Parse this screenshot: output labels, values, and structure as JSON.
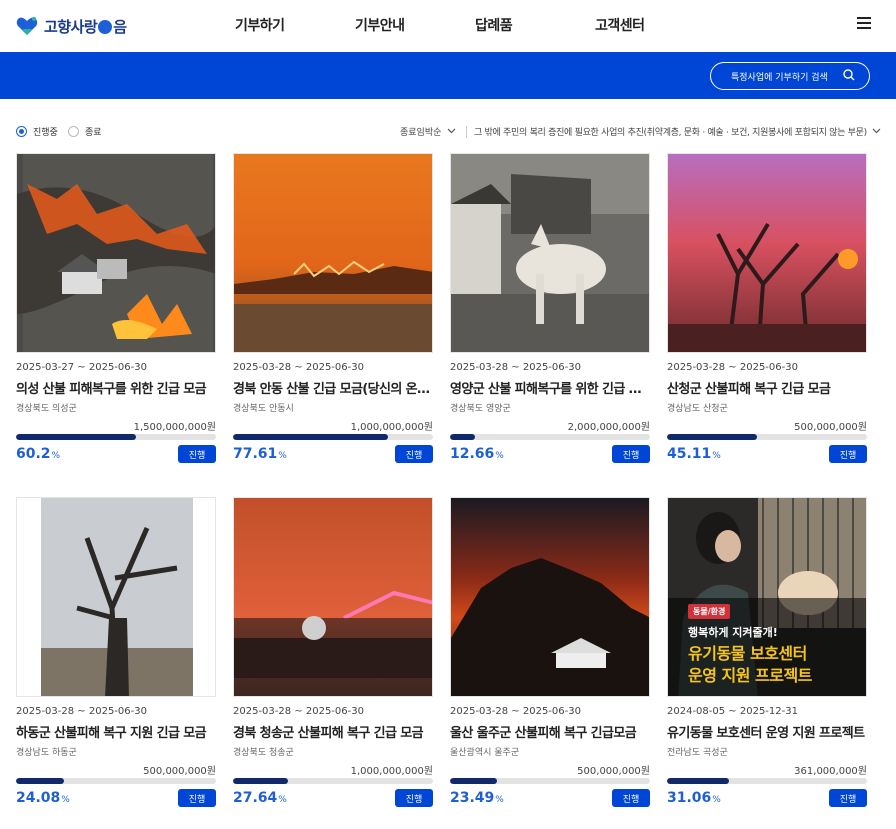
{
  "header": {
    "logo_text": "고향사랑",
    "logo_suffix": "음",
    "nav": [
      "기부하기",
      "기부안내",
      "답례품",
      "고객센터"
    ]
  },
  "banner": {
    "search_label": "특정사업에 기부하기 검색"
  },
  "filters": {
    "radio_active": "진행중",
    "radio_inactive": "종료",
    "sort": "종료임박순",
    "category": "그 밖에 주민의 복리 증진에 필요한 사업의 추진(취약계층, 문화 · 예술 · 보건, 지원봉사에 포함되지 않는 부문)"
  },
  "colors": {
    "brand_blue": "#0046d6",
    "progress_fill": "#10296b",
    "percent_text": "#1d5fd6"
  },
  "cards": [
    {
      "date": "2025-03-27 ~ 2025-06-30",
      "title": "의성 산불 피해복구를 위한 긴급 모금",
      "region": "경상북도 의성군",
      "amount": "1,500,000,000원",
      "percent": "60.2",
      "unit": "%",
      "progress": 60.2,
      "status": "진행"
    },
    {
      "date": "2025-03-28 ~ 2025-06-30",
      "title": "경북 안동 산불 긴급 모금(당신의 온정이 필요합니다)",
      "region": "경상북도 안동시",
      "amount": "1,000,000,000원",
      "percent": "77.61",
      "unit": "%",
      "progress": 77.61,
      "status": "진행"
    },
    {
      "date": "2025-03-28 ~ 2025-06-30",
      "title": "영양군 산불 피해복구를 위한 긴급 모금",
      "region": "경상북도 영양군",
      "amount": "2,000,000,000원",
      "percent": "12.66",
      "unit": "%",
      "progress": 12.66,
      "status": "진행"
    },
    {
      "date": "2025-03-28 ~ 2025-06-30",
      "title": "산청군 산불피해 복구 긴급 모금",
      "region": "경상남도 산청군",
      "amount": "500,000,000원",
      "percent": "45.11",
      "unit": "%",
      "progress": 45.11,
      "status": "진행"
    },
    {
      "date": "2025-03-28 ~ 2025-06-30",
      "title": "하동군 산불피해 복구 지원 긴급 모금",
      "region": "경상남도 하동군",
      "amount": "500,000,000원",
      "percent": "24.08",
      "unit": "%",
      "progress": 24.08,
      "status": "진행"
    },
    {
      "date": "2025-03-28 ~ 2025-06-30",
      "title": "경북 청송군 산불피해 복구 긴급 모금",
      "region": "경상북도 청송군",
      "amount": "1,000,000,000원",
      "percent": "27.64",
      "unit": "%",
      "progress": 27.64,
      "status": "진행"
    },
    {
      "date": "2025-03-28 ~ 2025-06-30",
      "title": "울산 울주군 산불피해 복구 긴급모금",
      "region": "울산광역시 울주군",
      "amount": "500,000,000원",
      "percent": "23.49",
      "unit": "%",
      "progress": 23.49,
      "status": "진행"
    },
    {
      "date": "2024-08-05 ~ 2025-12-31",
      "title": "유기동물 보호센터 운영 지원 프로젝트",
      "region": "전라남도 곡성군",
      "amount": "361,000,000원",
      "percent": "31.06",
      "unit": "%",
      "progress": 31.06,
      "status": "진행",
      "overlay": {
        "tag": "동물/환경",
        "line1": "행복하게 지켜줄개!",
        "line2": "유기동물 보호센터",
        "line3": "운영 지원 프로젝트"
      }
    }
  ]
}
